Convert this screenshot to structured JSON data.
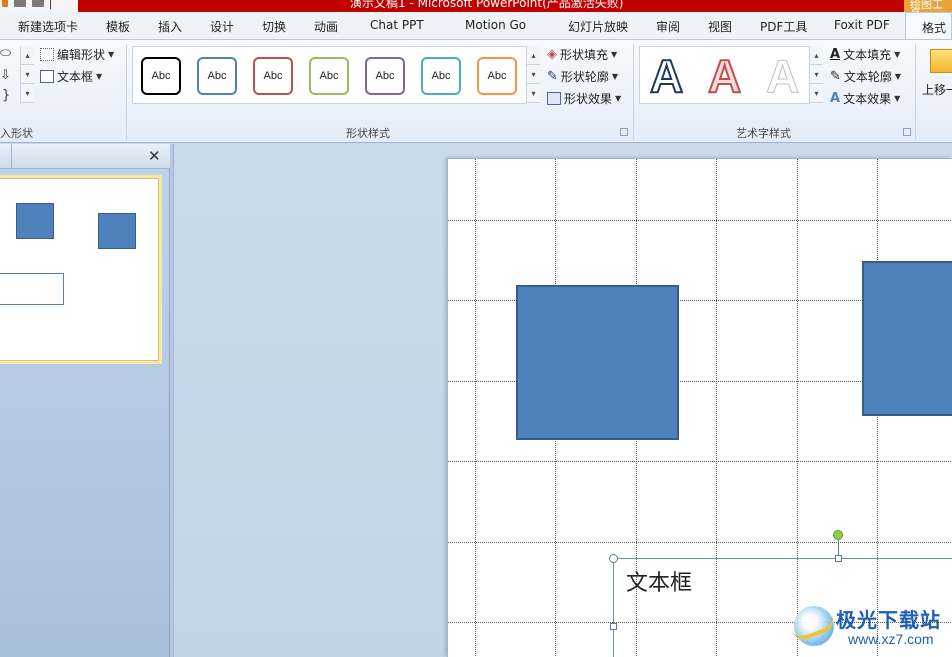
{
  "title_bar": {
    "title": "演示文稿1 - Microsoft PowerPoint(产品激活失败)",
    "context_tab_group": "绘图工具"
  },
  "tabs": [
    {
      "label": "新建选项卡"
    },
    {
      "label": "模板"
    },
    {
      "label": "插入"
    },
    {
      "label": "设计"
    },
    {
      "label": "切换"
    },
    {
      "label": "动画"
    },
    {
      "label": "Chat PPT"
    },
    {
      "label": "Motion Go"
    },
    {
      "label": "幻灯片放映"
    },
    {
      "label": "审阅"
    },
    {
      "label": "视图"
    },
    {
      "label": "PDF工具"
    },
    {
      "label": "Foxit PDF"
    }
  ],
  "active_tab": "格式",
  "ribbon": {
    "insert_shapes": {
      "label": "入形状",
      "edit_shape": "编辑形状",
      "text_box": "文本框"
    },
    "shape_styles": {
      "label": "形状样式",
      "presets": [
        {
          "text": "Abc",
          "color": "#000000"
        },
        {
          "text": "Abc",
          "color": "#4f81bd"
        },
        {
          "text": "Abc",
          "color": "#c0504d"
        },
        {
          "text": "Abc",
          "color": "#9bbb59"
        },
        {
          "text": "Abc",
          "color": "#8064a2"
        },
        {
          "text": "Abc",
          "color": "#4bacc6"
        },
        {
          "text": "Abc",
          "color": "#f79646"
        }
      ],
      "fill": "形状填充",
      "outline": "形状轮廓",
      "effects": "形状效果"
    },
    "wordart_styles": {
      "label": "艺术字样式",
      "samples": [
        {
          "letter": "A",
          "fill": "#ffffff",
          "stroke": "#1f3864"
        },
        {
          "letter": "A",
          "fill": "#f2dcdb",
          "stroke": "#c0504d"
        },
        {
          "letter": "A",
          "fill": "#ffffff",
          "stroke": "#bfbfbf"
        }
      ],
      "text_fill": "文本填充",
      "text_outline": "文本轮廓",
      "text_effects": "文本效果"
    },
    "arrange": {
      "bring_forward": "上移一"
    }
  },
  "slide": {
    "textbox_text": "文本框",
    "shape_color": "#4f81bd",
    "shape_border": "#385d8a"
  },
  "watermark": {
    "name": "极光下载站",
    "url": "www.xz7.com"
  }
}
